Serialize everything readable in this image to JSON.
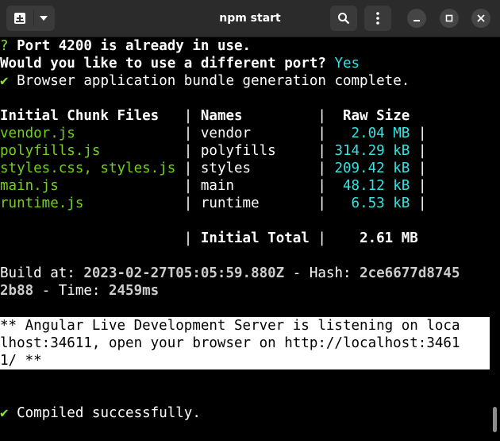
{
  "window": {
    "title": "npm start",
    "icons": [
      "new-tab-icon",
      "chevron-down-icon",
      "search-icon",
      "kebab-menu-icon",
      "minimize-icon",
      "maximize-icon",
      "close-icon"
    ]
  },
  "terminal": {
    "l1": {
      "q": "?",
      "text": " Port 4200 is already in use."
    },
    "l2": {
      "text": "Would you like to use a different port? ",
      "answer": "Yes"
    },
    "l3": {
      "check": "✔",
      "text": " Browser application bundle generation complete."
    },
    "table": {
      "headers": [
        "Initial Chunk Files",
        "Names",
        "Raw Size"
      ],
      "rows": [
        {
          "file": "vendor.js",
          "name": "vendor",
          "size": "2.04 MB"
        },
        {
          "file": "polyfills.js",
          "name": "polyfills",
          "size": "314.29 kB"
        },
        {
          "file": "styles.css, styles.js",
          "name": "styles",
          "size": "209.42 kB"
        },
        {
          "file": "main.js",
          "name": "main",
          "size": "48.12 kB"
        },
        {
          "file": "runtime.js",
          "name": "runtime",
          "size": "6.53 kB"
        }
      ],
      "total_label": "Initial Total",
      "total_value": "2.61 MB"
    },
    "build": {
      "label": "Build at: ",
      "timestamp": "2023-02-27T05:05:59.880Z",
      "hash_label": " - Hash: ",
      "hash_part1": "2ce6677d8745",
      "hash_part2": "2b88",
      "time_label": " - Time: ",
      "time_value": "2459ms"
    },
    "server": {
      "line1": "** Angular Live Development Server is listening on loca",
      "line2": "lhost:34611, open your browser on http://localhost:3461",
      "line3": "1/ **"
    },
    "compiled": {
      "check": "✔",
      "text": " Compiled successfully."
    }
  }
}
